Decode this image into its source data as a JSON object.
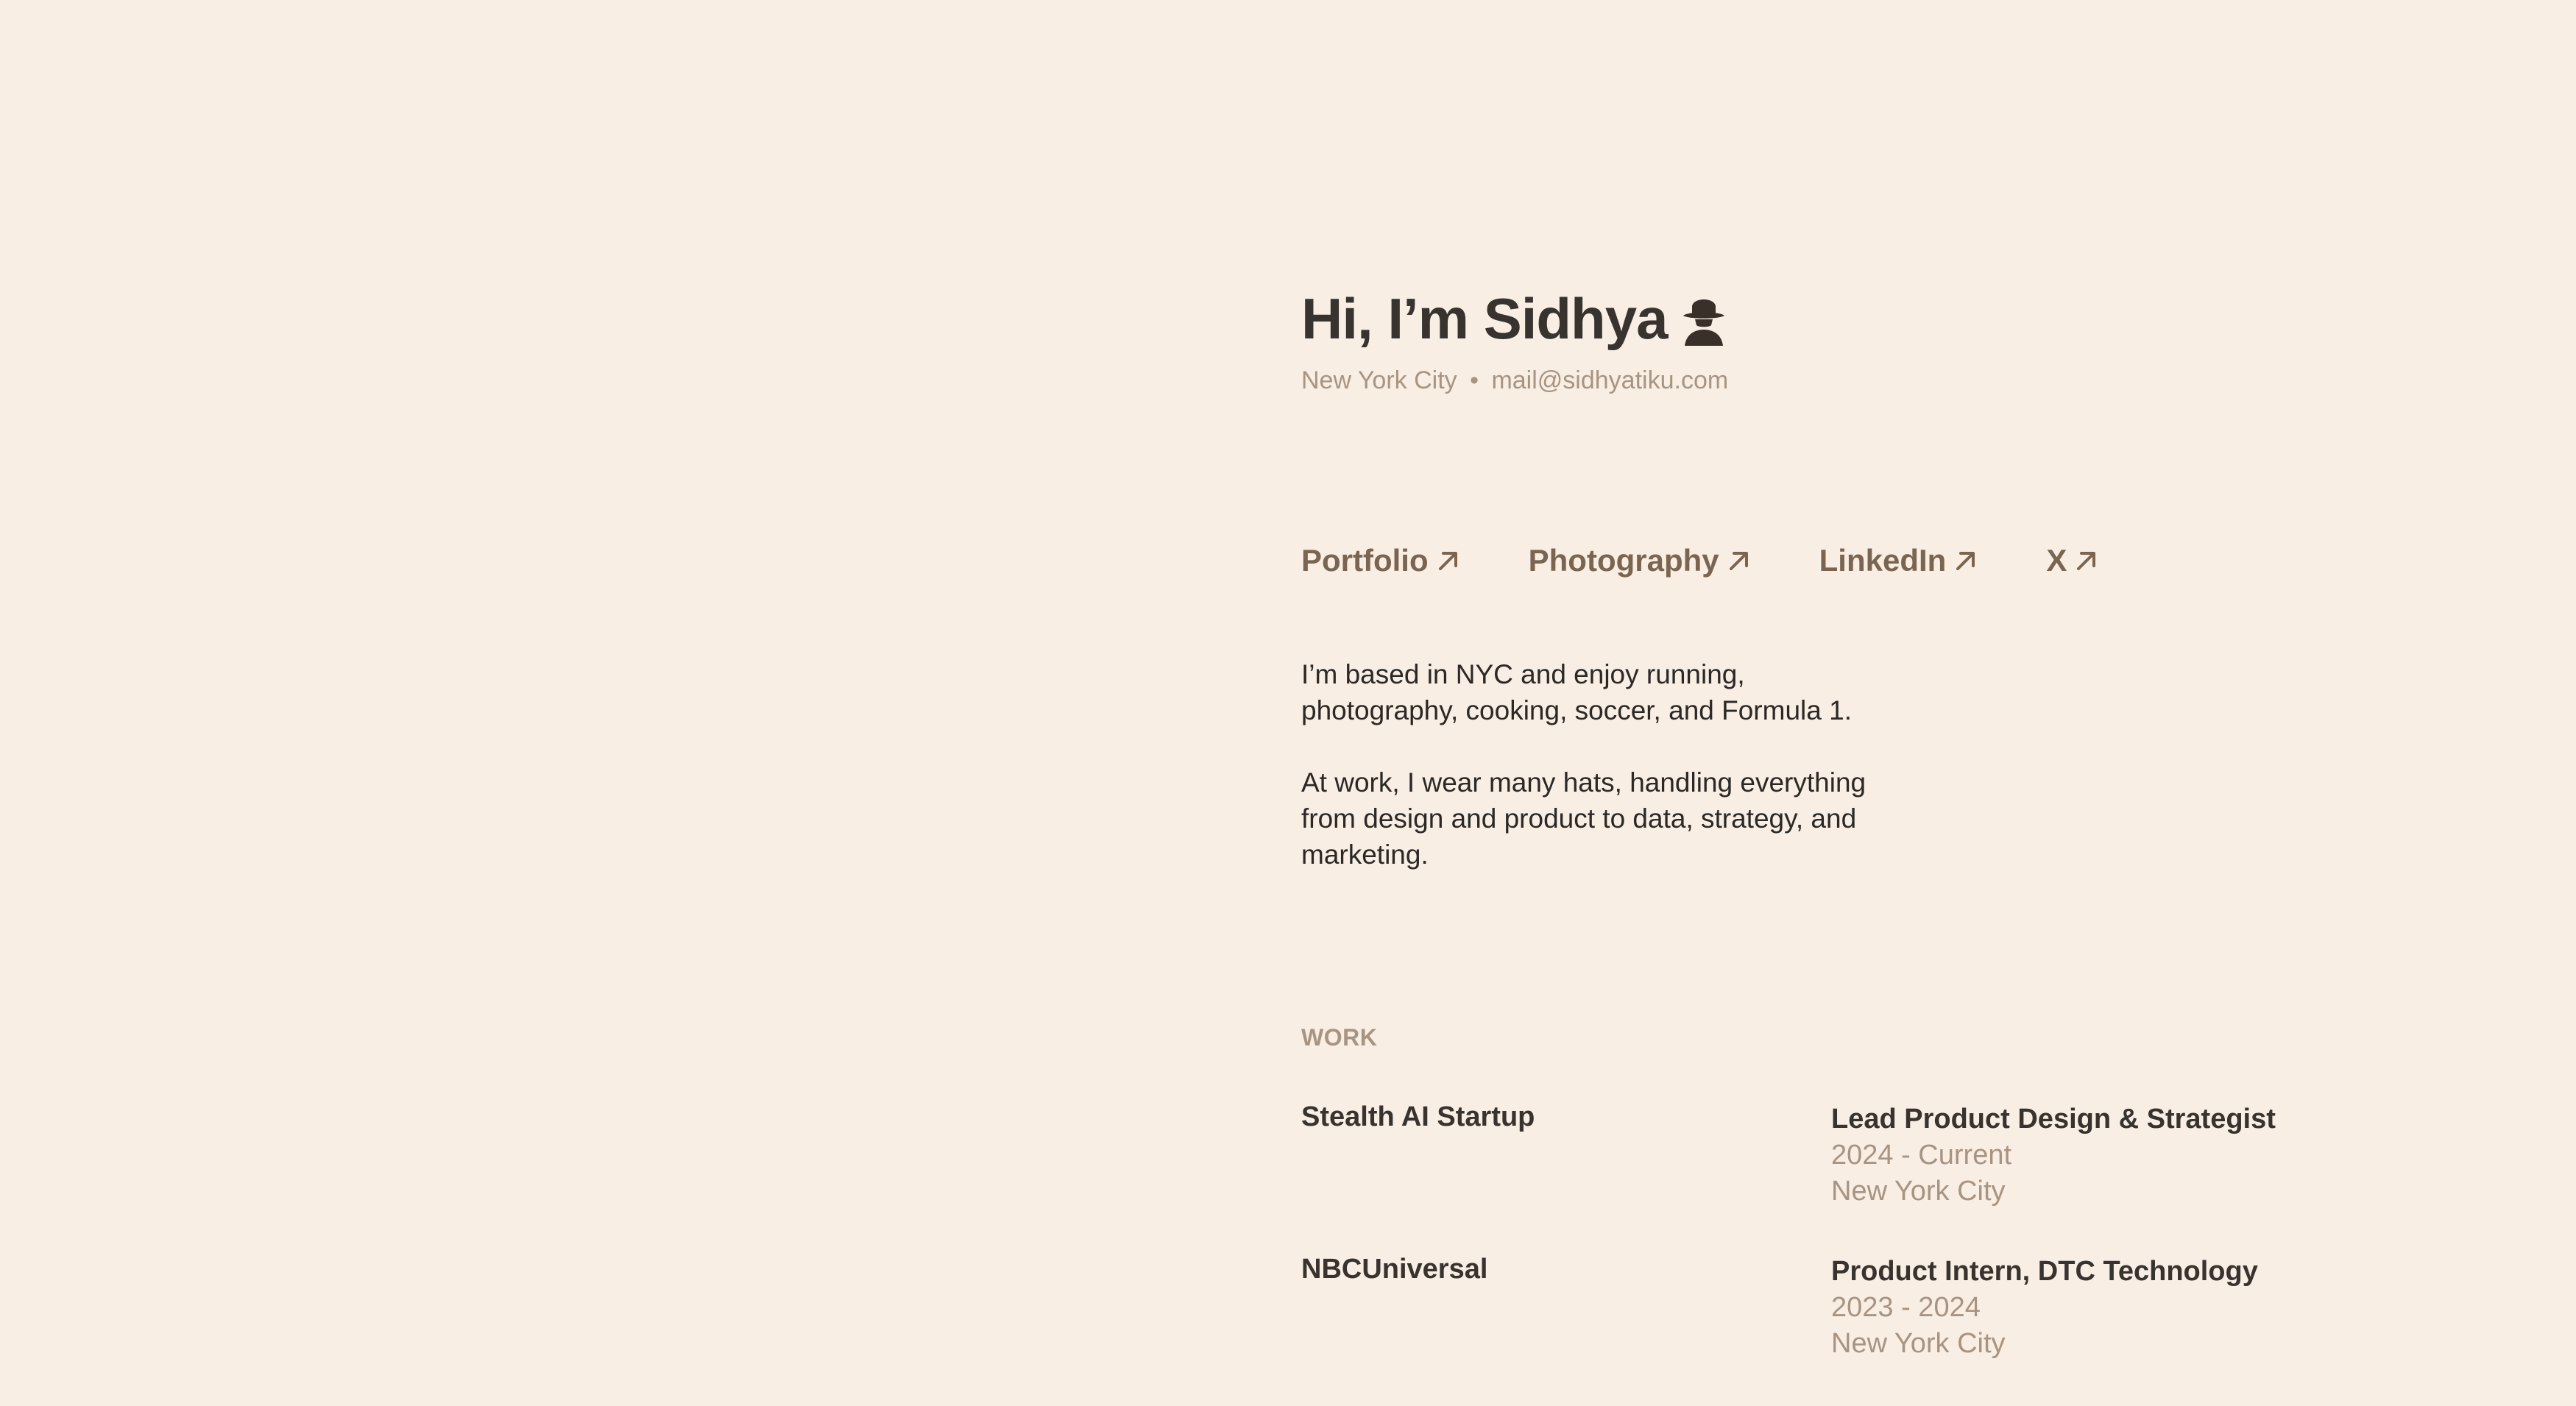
{
  "header": {
    "greeting": "Hi, I’m Sidhya",
    "location": "New York City",
    "separator": "•",
    "email": "mail@sidhyatiku.com"
  },
  "icons": {
    "greeting_icon": "spy-icon",
    "link_icon": "arrow-up-right-icon"
  },
  "links": [
    {
      "label": "Portfolio"
    },
    {
      "label": "Photography"
    },
    {
      "label": "LinkedIn"
    },
    {
      "label": "X"
    }
  ],
  "bio": {
    "p1": "I’m based in NYC and enjoy running, photography, cooking, soccer, and Formula 1.",
    "p2": "At work, I wear many hats, handling everything from design and product to data, strategy, and marketing."
  },
  "work": {
    "label": "WORK",
    "items": [
      {
        "company": "Stealth AI Startup",
        "role": "Lead Product Design & Strategist",
        "dates": "2024 - Current",
        "location": "New York City"
      },
      {
        "company": "NBCUniversal",
        "role": "Product Intern, DTC Technology",
        "dates": "2023 - 2024",
        "location": "New York City"
      }
    ]
  },
  "colors": {
    "background": "#f8eee4",
    "text_primary": "#38332f",
    "text_muted": "#a89482",
    "link": "#7b6550"
  }
}
